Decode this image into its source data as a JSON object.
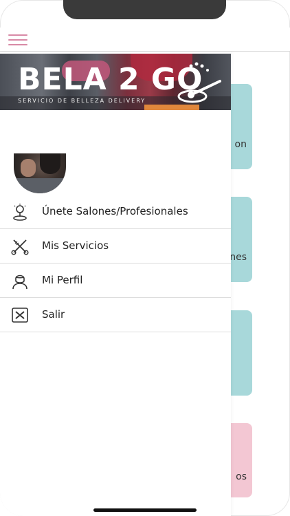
{
  "app": {
    "brand_name": "BELA 2 GO",
    "brand_tagline": "SERVICIO DE BELLEZA DELIVERY"
  },
  "drawer": {
    "items": [
      {
        "label": "Únete Salones/Profesionales",
        "icon": "salon-lamp-icon"
      },
      {
        "label": "Mis Servicios",
        "icon": "scissors-comb-icon"
      },
      {
        "label": "Mi Perfil",
        "icon": "user-profile-icon"
      },
      {
        "label": "Salir",
        "icon": "exit-x-icon"
      }
    ]
  },
  "background_cards": [
    {
      "label_fragment": "on",
      "color": "#a8d8da"
    },
    {
      "label_fragment": "nes",
      "color": "#a8d8da"
    },
    {
      "label_fragment": "",
      "color": "#a8d8da"
    },
    {
      "label_fragment": "os",
      "color": "#f3c7d3"
    }
  ],
  "colors": {
    "accent_pink": "#d88aa6",
    "card_teal": "#a8d8da",
    "card_pink": "#f3c7d3"
  }
}
